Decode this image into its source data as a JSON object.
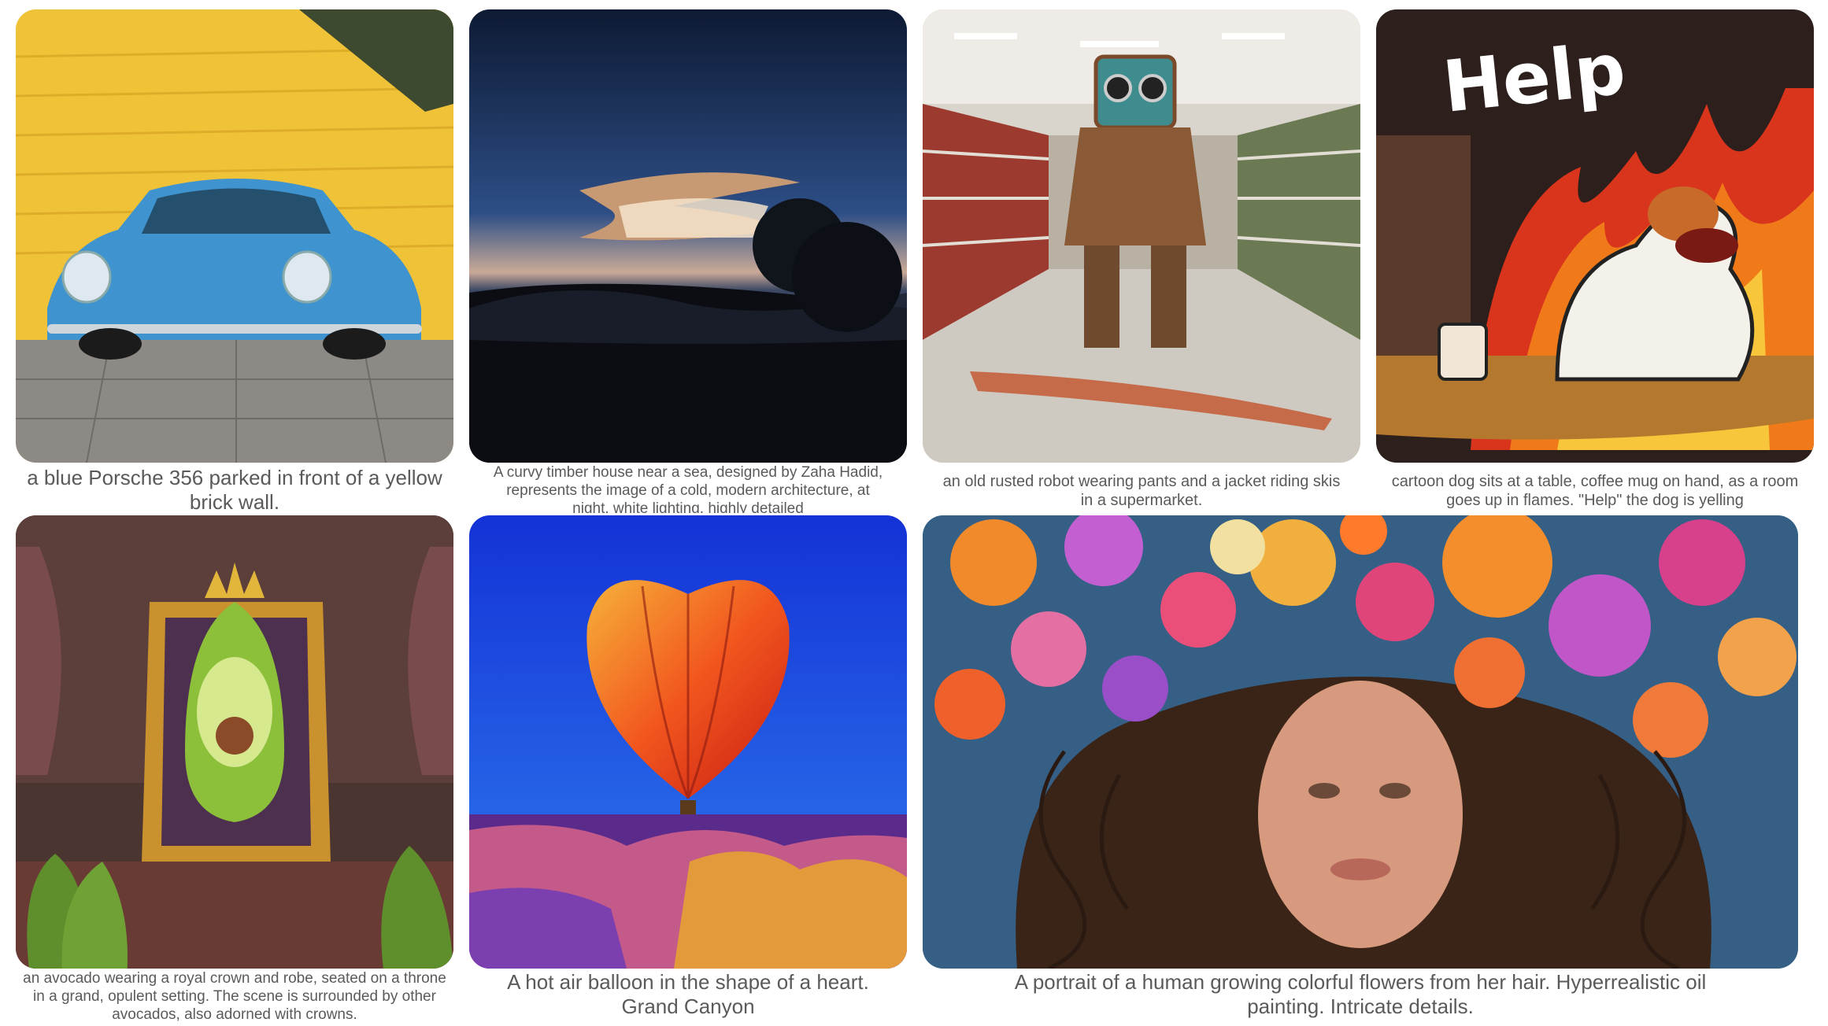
{
  "gallery": {
    "items": [
      {
        "caption": "a blue Porsche 356 parked in front of a yellow brick wall."
      },
      {
        "caption": "A curvy timber house near a sea, designed by Zaha Hadid, represents the image of a cold, modern architecture, at night, white lighting, highly detailed"
      },
      {
        "caption": "an old rusted robot wearing pants and a jacket riding skis in a supermarket."
      },
      {
        "caption": "cartoon dog sits at a table, coffee mug on hand, as a room goes up in flames. \"Help\" the dog is yelling",
        "sign_text": "Help"
      },
      {
        "caption": "an avocado wearing a royal crown and robe, seated on a throne in a grand, opulent setting. The scene is surrounded by other avocados, also adorned with crowns."
      },
      {
        "caption": "A hot air balloon in the shape of a heart. Grand Canyon"
      },
      {
        "caption": "A portrait of a human growing colorful flowers from her hair. Hyperrealistic oil painting. Intricate details."
      }
    ]
  }
}
